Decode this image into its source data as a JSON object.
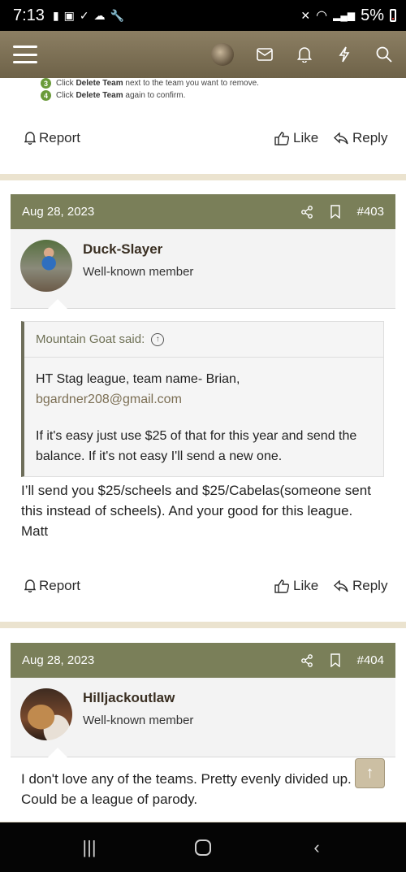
{
  "status_bar": {
    "time": "7:13",
    "battery_pct": "5%",
    "icons": [
      "alert-icon",
      "image-icon",
      "check-icon",
      "cloud-icon",
      "wrench-icon",
      "mute-icon",
      "wifi-icon",
      "signal-icon"
    ]
  },
  "app_header": {
    "icons": [
      "menu-icon",
      "avatar",
      "mail-icon",
      "bell-icon",
      "lightning-icon",
      "search-icon"
    ]
  },
  "top_post": {
    "steps": [
      {
        "num": "3",
        "pre": "Click ",
        "bold": "Delete Team",
        "post": " next to the team you want to remove."
      },
      {
        "num": "4",
        "pre": "Click ",
        "bold": "Delete Team",
        "post": " again to confirm."
      }
    ],
    "report": "Report",
    "like": "Like",
    "reply": "Reply"
  },
  "posts": [
    {
      "date": "Aug 28, 2023",
      "number": "#403",
      "username": "Duck-Slayer",
      "user_title": "Well-known member",
      "quote": {
        "author": "Mountain Goat said:",
        "line1": "HT Stag league, team name- Brian,",
        "email": "bgardner208@gmail.com",
        "line2": "If it's easy just use $25 of that for this year and send the balance. If it's not easy I'll send a new one."
      },
      "body": "I’ll send you $25/scheels and $25/Cabelas(someone sent this instead of scheels). And your good for this league.",
      "signoff": "Matt",
      "report": "Report",
      "like": "Like",
      "reply": "Reply"
    },
    {
      "date": "Aug 28, 2023",
      "number": "#404",
      "username": "Hilljackoutlaw",
      "user_title": "Well-known member",
      "body": "I don't love any of the teams. Pretty evenly divided up. Could be a league of parody."
    }
  ],
  "colors": {
    "header_olive": "#7a7f59",
    "appbar_brown": "#7d7156",
    "page_bg": "#ebe3cf"
  }
}
